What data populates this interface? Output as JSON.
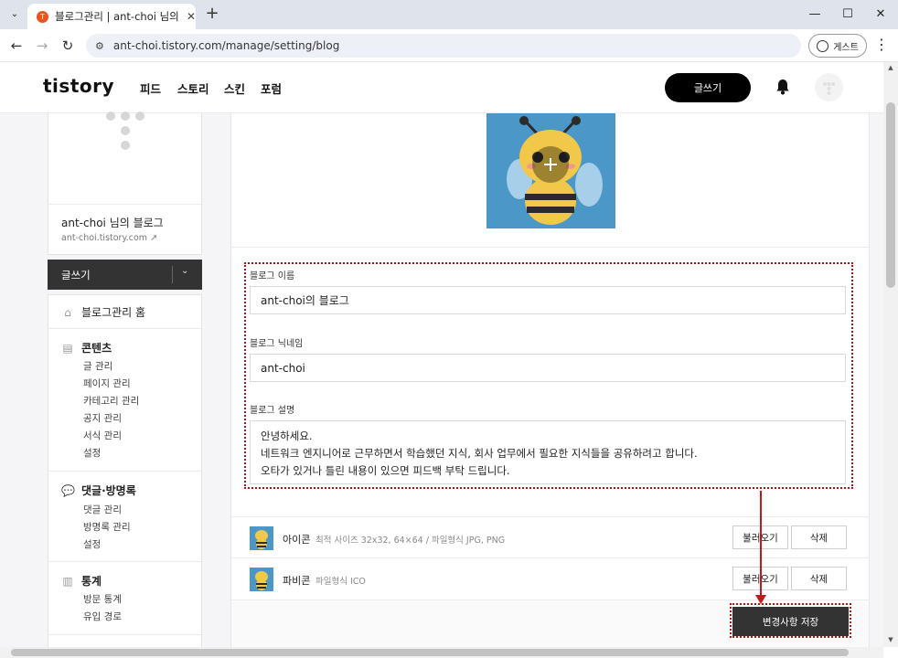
{
  "browser": {
    "tab_title": "블로그관리 | ant-choi 님의 블로그",
    "favicon": "T",
    "url": "ant-choi.tistory.com/manage/setting/blog",
    "profile_label": "게스트",
    "new_tab": "+",
    "tab_close": "✕",
    "minimize": "—",
    "maximize": "☐",
    "close": "✕"
  },
  "header": {
    "logo": "tistory",
    "nav": [
      "피드",
      "스토리",
      "스킨",
      "포럼"
    ],
    "write_button": "글쓰기"
  },
  "sidebar": {
    "blog_name": "ant-choi 님의 블로그",
    "blog_url": "ant-choi.tistory.com",
    "write_button": "글쓰기",
    "home": "블로그관리 홈",
    "sections": [
      {
        "title": "콘텐츠",
        "icon": "document-icon",
        "items": [
          "글 관리",
          "페이지 관리",
          "카테고리 관리",
          "공지 관리",
          "서식 관리",
          "설정"
        ]
      },
      {
        "title": "댓글·방명록",
        "icon": "comment-icon",
        "items": [
          "댓글 관리",
          "방명록 관리",
          "설정"
        ]
      },
      {
        "title": "통계",
        "icon": "chart-icon",
        "items": [
          "방문 통계",
          "유입 경로"
        ]
      }
    ]
  },
  "form": {
    "name_label": "블로그 이름",
    "name_value": "ant-choi의 블로그",
    "nickname_label": "블로그 닉네임",
    "nickname_value": "ant-choi",
    "desc_label": "블로그 설명",
    "desc_lines": [
      "안녕하세요.",
      "네트워크 엔지니어로 근무하면서 학습했던 지식, 회사 업무에서 필요한 지식들을 공유하려고 합니다.",
      "오타가 있거나 틀린 내용이 있으면 피드백 부탁 드립니다."
    ]
  },
  "icon_row": {
    "name": "아이콘",
    "hint": "최적 사이즈 32x32, 64×64 / 파일형식 JPG, PNG",
    "load": "불러오기",
    "delete": "삭제"
  },
  "favicon_row": {
    "name": "파비콘",
    "hint": "파일형식 ICO",
    "load": "불러오기",
    "delete": "삭제"
  },
  "save_button": "변경사항 저장",
  "colors": {
    "accent": "#000000",
    "annotation": "#c0181c",
    "bee_bg": "#4a97c8"
  }
}
